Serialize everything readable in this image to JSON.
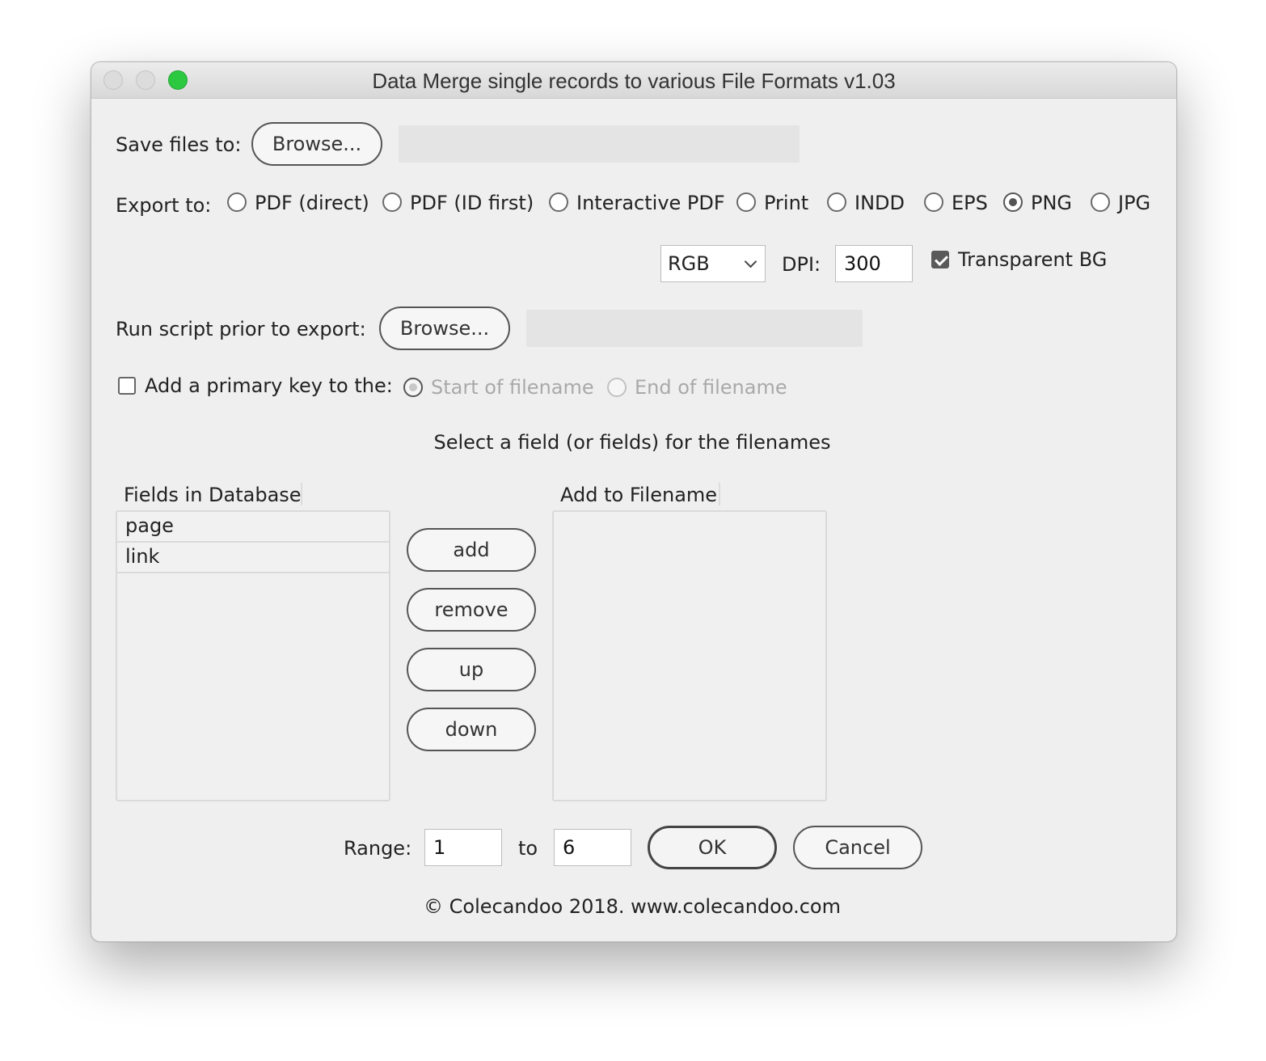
{
  "window": {
    "title": "Data Merge single records to various File Formats v1.03"
  },
  "save": {
    "label": "Save files to:",
    "browse_label": "Browse...",
    "path": ""
  },
  "export": {
    "label": "Export to:",
    "options": [
      "PDF (direct)",
      "PDF (ID first)",
      "Interactive PDF",
      "Print",
      "INDD",
      "EPS",
      "PNG",
      "JPG"
    ],
    "selected": "PNG"
  },
  "png": {
    "color_mode": "RGB",
    "dpi_label": "DPI:",
    "dpi": "300",
    "transparent_label": "Transparent BG",
    "transparent_checked": true
  },
  "script": {
    "label": "Run script prior to export:",
    "browse_label": "Browse...",
    "path": ""
  },
  "primary_key": {
    "label": "Add a primary key to the:",
    "checked": false,
    "start_label": "Start of filename",
    "end_label": "End of filename",
    "selected": "Start of filename"
  },
  "fields": {
    "instruction": "Select a field (or fields) for the filenames",
    "db_header": "Fields in Database",
    "db_items": [
      "page",
      "link"
    ],
    "filename_header": "Add to Filename",
    "filename_items": []
  },
  "actions": {
    "add": "add",
    "remove": "remove",
    "up": "up",
    "down": "down"
  },
  "range": {
    "label": "Range:",
    "from": "1",
    "to_label": "to",
    "to": "6"
  },
  "dialog": {
    "ok": "OK",
    "cancel": "Cancel"
  },
  "footer": {
    "copyright": "© Colecandoo 2018. www.colecandoo.com"
  }
}
